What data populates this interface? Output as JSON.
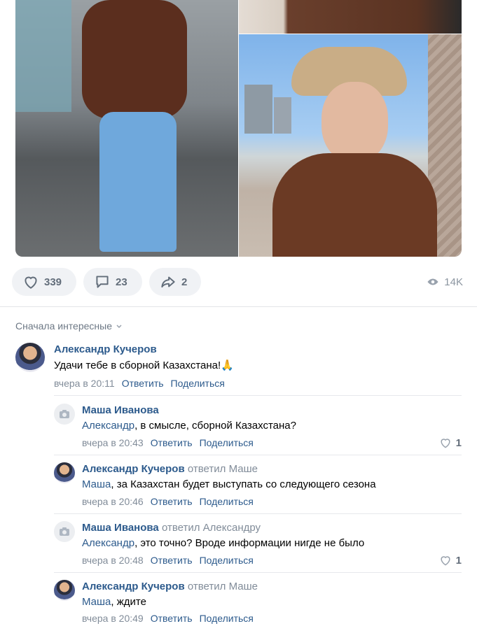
{
  "post": {
    "likes": "339",
    "comments": "23",
    "shares": "2",
    "views": "14K"
  },
  "sort": {
    "label": "Сначала интересные"
  },
  "comments": [
    {
      "author": "Александр Кучеров",
      "reply_to": "",
      "addressee": "",
      "text": "Удачи тебе в сборной Казахстана!🙏",
      "time": "вчера в 20:11",
      "reply_label": "Ответить",
      "share_label": "Поделиться",
      "likes": ""
    },
    {
      "author": "Маша Иванова",
      "reply_to": "",
      "addressee": "Александр",
      "text": ", в смысле, сборной Казахстана?",
      "time": "вчера в 20:43",
      "reply_label": "Ответить",
      "share_label": "Поделиться",
      "likes": "1"
    },
    {
      "author": "Александр Кучеров",
      "reply_to": "ответил Маше",
      "addressee": "Маша",
      "text": ", за Казахстан будет выступать со следующего сезона",
      "time": "вчера в 20:46",
      "reply_label": "Ответить",
      "share_label": "Поделиться",
      "likes": ""
    },
    {
      "author": "Маша Иванова",
      "reply_to": "ответил Александру",
      "addressee": "Александр",
      "text": ", это точно? Вроде информации нигде не было",
      "time": "вчера в 20:48",
      "reply_label": "Ответить",
      "share_label": "Поделиться",
      "likes": "1"
    },
    {
      "author": "Александр Кучеров",
      "reply_to": "ответил Маше",
      "addressee": "Маша",
      "text": ", ждите",
      "time": "вчера в 20:49",
      "reply_label": "Ответить",
      "share_label": "Поделиться",
      "likes": ""
    }
  ]
}
